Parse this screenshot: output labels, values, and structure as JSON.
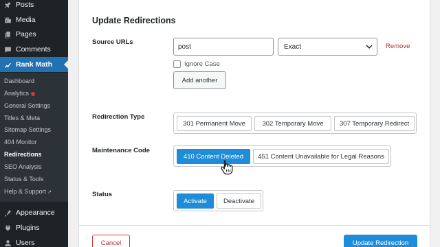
{
  "sidebar": {
    "menu": [
      {
        "label": "Posts",
        "icon": "pin-icon"
      },
      {
        "label": "Media",
        "icon": "media-icon"
      },
      {
        "label": "Pages",
        "icon": "pages-icon"
      },
      {
        "label": "Comments",
        "icon": "comments-icon"
      },
      {
        "label": "Rank Math",
        "icon": "rank-math-icon"
      }
    ],
    "submenu": [
      "Dashboard",
      "Analytics",
      "General Settings",
      "Titles & Meta",
      "Sitemap Settings",
      "404 Monitor",
      "Redirections",
      "SEO Analysis",
      "Status & Tools",
      "Help & Support"
    ],
    "bottom_menu": [
      {
        "label": "Appearance",
        "icon": "appearance-icon"
      },
      {
        "label": "Plugins",
        "icon": "plugins-icon"
      },
      {
        "label": "Users",
        "icon": "users-icon"
      }
    ],
    "active_item": "Rank Math",
    "current_subitem": "Redirections",
    "accent_color": "#2271b1",
    "notification_dot_color": "#d63638"
  },
  "panel": {
    "title": "Update Redirections",
    "source_urls": {
      "label": "Source URLs",
      "url_value": "post",
      "match_type": "Exact",
      "remove_label": "Remove",
      "ignore_case_label": "Ignore Case",
      "ignore_case_checked": false,
      "add_another_label": "Add another"
    },
    "redirection_type": {
      "label": "Redirection Type",
      "options": [
        "301 Permanent Move",
        "302 Temporary Move",
        "307 Temporary Redirect"
      ]
    },
    "maintenance_code": {
      "label": "Maintenance Code",
      "options": [
        "410 Content Deleted",
        "451 Content Unavailable for Legal Reasons"
      ],
      "selected": "410 Content Deleted"
    },
    "status": {
      "label": "Status",
      "options": [
        "Activate",
        "Deactivate"
      ],
      "selected": "Activate"
    },
    "footer": {
      "cancel_label": "Cancel",
      "update_label": "Update Redirection"
    },
    "primary_color": "#1e8cd8"
  }
}
